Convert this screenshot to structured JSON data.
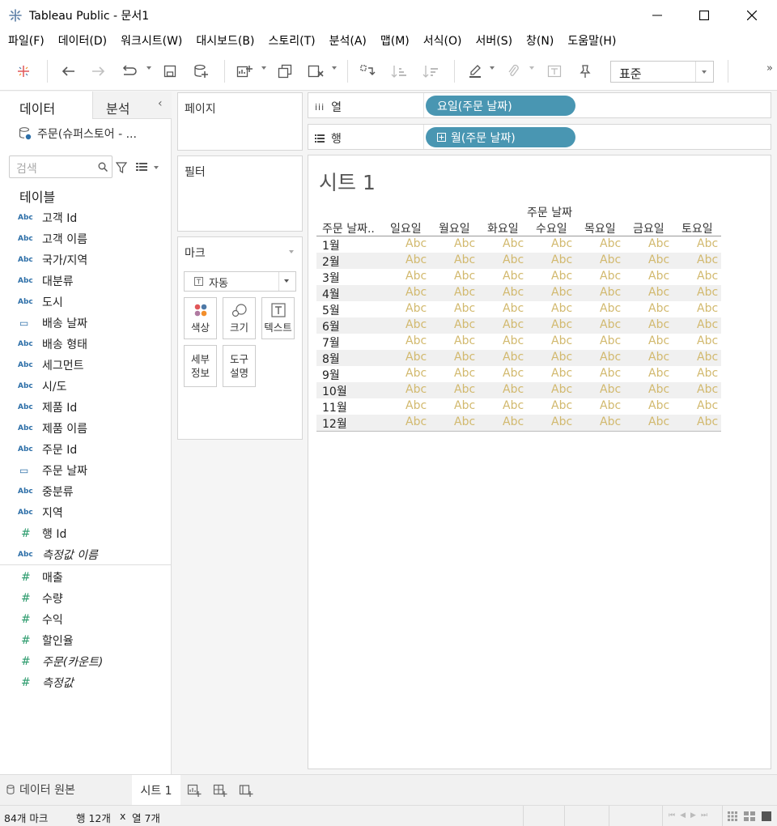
{
  "window": {
    "title": "Tableau Public - 문서1"
  },
  "menu": [
    "파일(F)",
    "데이터(D)",
    "워크시트(W)",
    "대시보드(B)",
    "스토리(T)",
    "분석(A)",
    "맵(M)",
    "서식(O)",
    "서버(S)",
    "창(N)",
    "도움말(H)"
  ],
  "toolbar": {
    "fit_value": "표준",
    "overflow": "»"
  },
  "data_pane": {
    "tab_data": "데이터",
    "tab_analysis": "분석",
    "datasource": "주문(슈퍼스토어 - ...",
    "search_placeholder": "검색",
    "section_title": "테이블",
    "fields": [
      {
        "type": "Abc",
        "name": "고객 Id",
        "kind": "dim"
      },
      {
        "type": "Abc",
        "name": "고객 이름",
        "kind": "dim"
      },
      {
        "type": "Abc",
        "name": "국가/지역",
        "kind": "dim"
      },
      {
        "type": "Abc",
        "name": "대분류",
        "kind": "dim"
      },
      {
        "type": "Abc",
        "name": "도시",
        "kind": "dim"
      },
      {
        "type": "date",
        "name": "배송 날짜",
        "kind": "dim"
      },
      {
        "type": "Abc",
        "name": "배송 형태",
        "kind": "dim"
      },
      {
        "type": "Abc",
        "name": "세그먼트",
        "kind": "dim"
      },
      {
        "type": "Abc",
        "name": "시/도",
        "kind": "dim"
      },
      {
        "type": "Abc",
        "name": "제품 Id",
        "kind": "dim"
      },
      {
        "type": "Abc",
        "name": "제품 이름",
        "kind": "dim"
      },
      {
        "type": "Abc",
        "name": "주문 Id",
        "kind": "dim"
      },
      {
        "type": "date",
        "name": "주문 날짜",
        "kind": "dim"
      },
      {
        "type": "Abc",
        "name": "중분류",
        "kind": "dim"
      },
      {
        "type": "Abc",
        "name": "지역",
        "kind": "dim"
      },
      {
        "type": "#",
        "name": "행 Id",
        "kind": "dim"
      },
      {
        "type": "Abc",
        "name": "측정값 이름",
        "kind": "dim",
        "italic": true
      },
      {
        "type": "#",
        "name": "매출",
        "kind": "measure"
      },
      {
        "type": "#",
        "name": "수량",
        "kind": "measure"
      },
      {
        "type": "#",
        "name": "수익",
        "kind": "measure"
      },
      {
        "type": "#",
        "name": "할인율",
        "kind": "measure"
      },
      {
        "type": "#",
        "name": "주문(카운트)",
        "kind": "measure",
        "italic": true
      },
      {
        "type": "#",
        "name": "측정값",
        "kind": "measure",
        "italic": true
      }
    ]
  },
  "shelves": {
    "pages_label": "페이지",
    "filters_label": "필터",
    "marks_label": "마크",
    "marks_type": "자동",
    "mark_buttons": [
      "색상",
      "크기",
      "텍스트"
    ],
    "mark_detail": [
      "세부",
      "정보"
    ],
    "mark_tooltip": [
      "도구",
      "설명"
    ],
    "columns_label": "열",
    "columns_pill": "요일(주문 날짜)",
    "rows_label": "행",
    "rows_pill": "월(주문 날짜)"
  },
  "view": {
    "sheet_title": "시트 1",
    "column_field_header": "주문 날짜",
    "row_field_header": "주문 날짜..",
    "columns": [
      "일요일",
      "월요일",
      "화요일",
      "수요일",
      "목요일",
      "금요일",
      "토요일"
    ],
    "rows": [
      "1월",
      "2월",
      "3월",
      "4월",
      "5월",
      "6월",
      "7월",
      "8월",
      "9월",
      "10월",
      "11월",
      "12월"
    ],
    "cell_text": "Abc",
    "cell_color": "#d2b96e"
  },
  "sheet_tabs": {
    "datasource_tab": "데이터 원본",
    "active_sheet": "시트 1"
  },
  "status": {
    "marks": "84개 마크",
    "rows": "행 12개",
    "x": "x",
    "cols": "열 7개"
  },
  "colors": {
    "pill": "#4996b2",
    "accent_green": "#2a9a6b",
    "accent_blue": "#2d6fa8"
  }
}
